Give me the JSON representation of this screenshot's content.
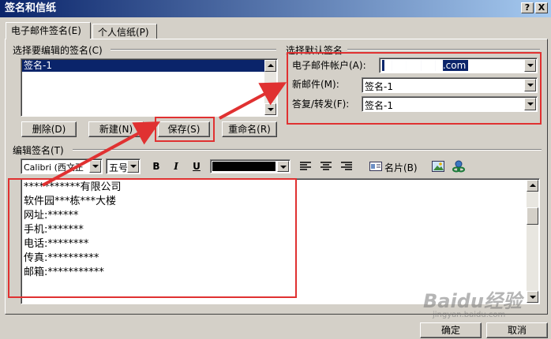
{
  "window": {
    "title": "签名和信纸",
    "help_label": "?",
    "close_label": "X"
  },
  "tabs": [
    {
      "label": "电子邮件签名(E)"
    },
    {
      "label": "个人信纸(P)"
    }
  ],
  "select_group": {
    "title": "选择要编辑的签名(C)",
    "items": [
      "签名-1"
    ]
  },
  "default_group": {
    "title": "选择默认签名",
    "account_label": "电子邮件帐户(A):",
    "account_value": "████████.com",
    "new_mail_label": "新邮件(M):",
    "new_mail_value": "签名-1",
    "reply_label": "答复/转发(F):",
    "reply_value": "签名-1"
  },
  "buttons": {
    "delete": "删除(D)",
    "new": "新建(N)",
    "save": "保存(S)",
    "rename": "重命名(R)",
    "ok": "确定",
    "cancel": "取消"
  },
  "edit_group": {
    "title": "编辑签名(T)",
    "font_value": "Calibri (西文正",
    "size_value": "五号",
    "bold": "B",
    "italic": "I",
    "underline": "U",
    "card_label": "名片(B)"
  },
  "signature_lines": [
    "***********有限公司",
    "软件园***栋***大楼",
    "网址:******",
    "手机:*******",
    "电话:********",
    "传真:**********",
    "邮箱:***********"
  ],
  "watermark": {
    "text": "Baidu经验",
    "url": "jingyan.baidu.com"
  },
  "colors": {
    "annotation": "#e03131",
    "title_bar": "#0a246a",
    "selection": "#0a246a"
  }
}
